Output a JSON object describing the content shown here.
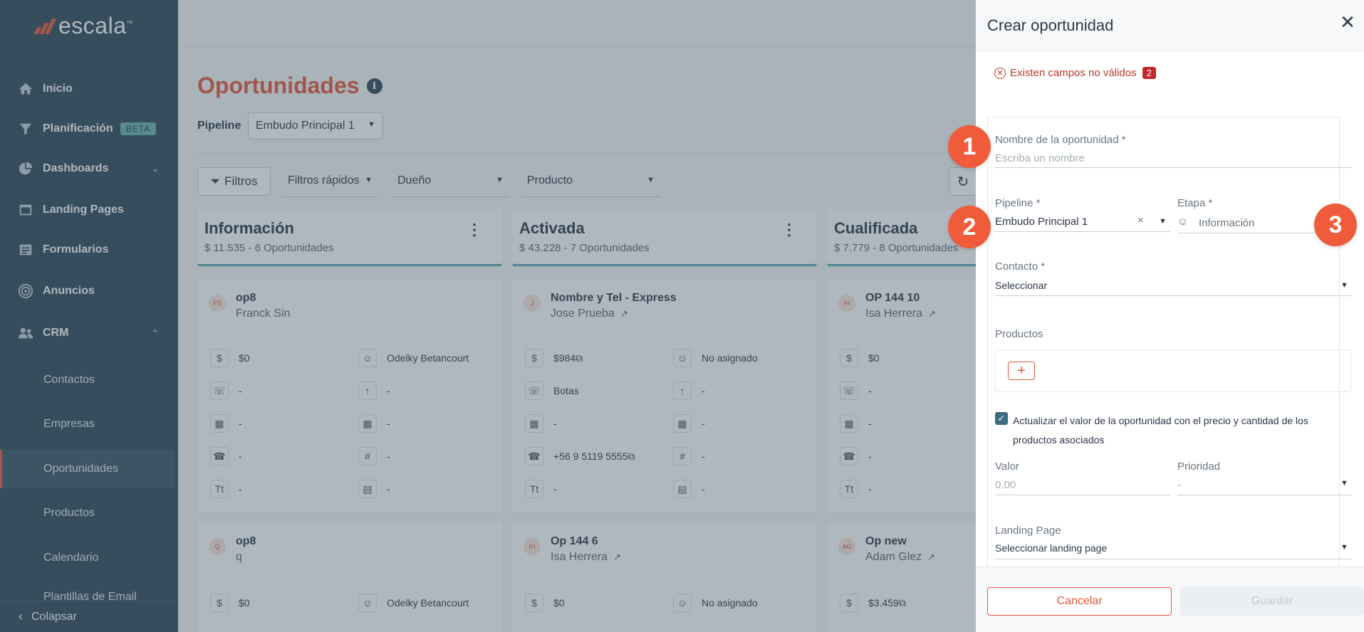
{
  "logo": {
    "text": "escala",
    "tm": "™"
  },
  "sidebar": {
    "items": [
      {
        "label": "Inicio",
        "icon": "home-icon"
      },
      {
        "label": "Planificación",
        "icon": "funnel-icon",
        "badge": "BETA"
      },
      {
        "label": "Dashboards",
        "icon": "pie-chart-icon"
      },
      {
        "label": "Landing Pages",
        "icon": "landing-icon"
      },
      {
        "label": "Formularios",
        "icon": "form-icon"
      },
      {
        "label": "Anuncios",
        "icon": "target-icon"
      },
      {
        "label": "CRM",
        "icon": "people-icon"
      }
    ],
    "crm_children": [
      "Contactos",
      "Empresas",
      "Oportunidades",
      "Productos",
      "Calendario",
      "Plantillas de Email"
    ],
    "collapse_label": "Colapsar"
  },
  "page": {
    "title": "Oportunidades",
    "pipeline_label": "Pipeline",
    "pipeline_value": "Embudo Principal 1",
    "filters_label": "Filtros",
    "quick_filters": "Filtros rápidos",
    "owner": "Dueño",
    "product": "Producto"
  },
  "columns": [
    {
      "title": "Información",
      "summary": "$ 11.535 - 6 Oportunidades",
      "cards": [
        {
          "initials": "FS",
          "title": "op8",
          "person": "Franck Sin",
          "ext": false,
          "f1": "$0",
          "f2": "Odelky Betancourt",
          "f3": "-",
          "f4": "-",
          "f5": "-",
          "f6": "-",
          "f7": "-",
          "f8": "-",
          "f9": "-",
          "f10": "-"
        },
        {
          "initials": "Q",
          "title": "op8",
          "person": "q",
          "ext": false,
          "f1": "$0",
          "f2": "Odelky Betancourt"
        }
      ]
    },
    {
      "title": "Activada",
      "summary": "$ 43.228 - 7 Oportunidades",
      "cards": [
        {
          "initials": "J",
          "title": "Nombre y Tel - Express",
          "person": "Jose Prueba",
          "ext": true,
          "f1": "$984",
          "f2": "No asignado",
          "f3": "Botas",
          "f4": "-",
          "f5": "-",
          "f6": "-",
          "f7": "+56 9 5119 5555",
          "f8": "-",
          "f9": "-",
          "f10": "-"
        },
        {
          "initials": "IH",
          "title": "Op 144 6",
          "person": "Isa Herrera",
          "ext": true,
          "f1": "$0",
          "f2": "No asignado"
        }
      ]
    },
    {
      "title": "Cualificada",
      "summary": "$ 7.779 - 8 Oportunidades",
      "cards": [
        {
          "initials": "IH",
          "title": "OP 144 10",
          "person": "Isa Herrera",
          "ext": true,
          "f1": "$0",
          "f3": "-",
          "f5": "-",
          "f7": "-",
          "f9": "-"
        },
        {
          "initials": "AG",
          "title": "Op new",
          "person": "Adam Glez",
          "ext": true,
          "f1": "$3.459"
        }
      ]
    }
  ],
  "drawer": {
    "title": "Crear oportunidad",
    "error_text": "Existen campos no válidos",
    "error_count": "2",
    "name_label": "Nombre de la oportunidad *",
    "name_placeholder": "Escriba un nombre",
    "pipeline_label": "Pipeline *",
    "pipeline_value": "Embudo Principal 1",
    "stage_label": "Etapa *",
    "stage_value": "Información",
    "contact_label": "Contacto *",
    "contact_value": "Seleccionar",
    "products_label": "Productos",
    "update_checkbox_text": "Actualizar el valor de la oportunidad con el precio y cantidad de los productos asociados",
    "update_checked": true,
    "value_label": "Valor",
    "value_placeholder": "0.00",
    "priority_label": "Prioridad",
    "priority_value": "-",
    "landing_label": "Landing Page",
    "landing_value": "Seleccionar landing page",
    "cancel_label": "Cancelar",
    "save_label": "Guardar"
  },
  "callouts": [
    "1",
    "2",
    "3"
  ],
  "colors": {
    "accent": "#e8553a",
    "sidebar": "#2f4858",
    "callout": "#ef5b3b"
  }
}
